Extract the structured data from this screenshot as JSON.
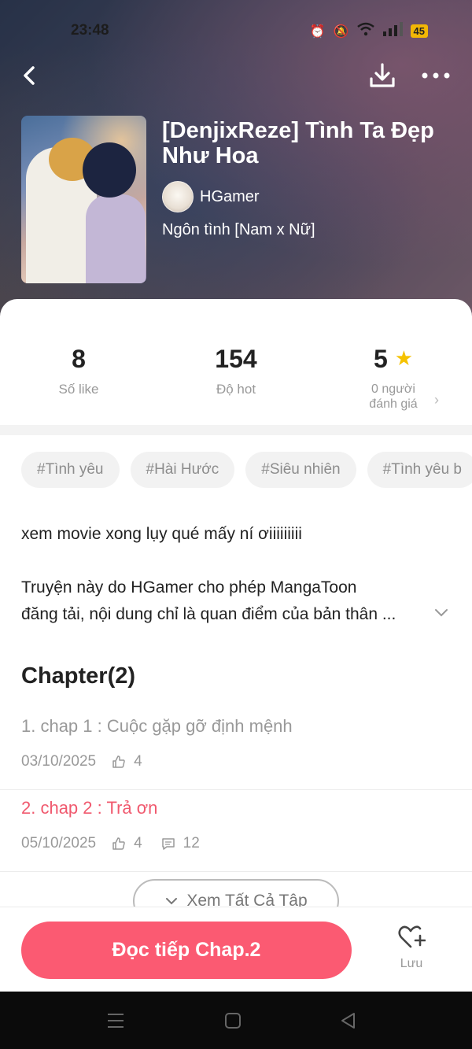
{
  "status_bar": {
    "time": "23:48",
    "battery": "45"
  },
  "book": {
    "title": "[DenjixReze] Tình Ta Đẹp Như Hoa",
    "author": "HGamer",
    "genre": "Ngôn tình [Nam x Nữ]"
  },
  "stats": {
    "likes": {
      "value": "8",
      "label": "Số like"
    },
    "hot": {
      "value": "154",
      "label": "Độ hot"
    },
    "rating": {
      "value": "5",
      "reviewers_line1": "0 người",
      "reviewers_line2": "đánh giá"
    }
  },
  "tags": [
    "#Tình yêu",
    "#Hài Hước",
    "#Siêu nhiên",
    "#Tình yêu b"
  ],
  "description": {
    "line1": "xem movie xong lụy qué mấy ní ơiiiiiiiii",
    "line2": "Truyện này do HGamer cho phép MangaToon",
    "line3": "đăng tải, nội dung chỉ là quan điểm của bản thân ..."
  },
  "chapters": {
    "heading": "Chapter(2)",
    "items": [
      {
        "title": "1. chap 1 : Cuộc gặp gỡ định mệnh",
        "date": "03/10/2025",
        "likes": "4",
        "comments": ""
      },
      {
        "title": "2. chap 2 : Trả ơn",
        "date": "05/10/2025",
        "likes": "4",
        "comments": "12"
      }
    ],
    "see_all": "Xem Tất Cả Tập"
  },
  "bottom_bar": {
    "read_button": "Đọc tiếp Chap.2",
    "save_label": "Lưu"
  },
  "colors": {
    "accent": "#fb5a72",
    "active_chapter": "#f0596e",
    "star": "#f5c200"
  }
}
